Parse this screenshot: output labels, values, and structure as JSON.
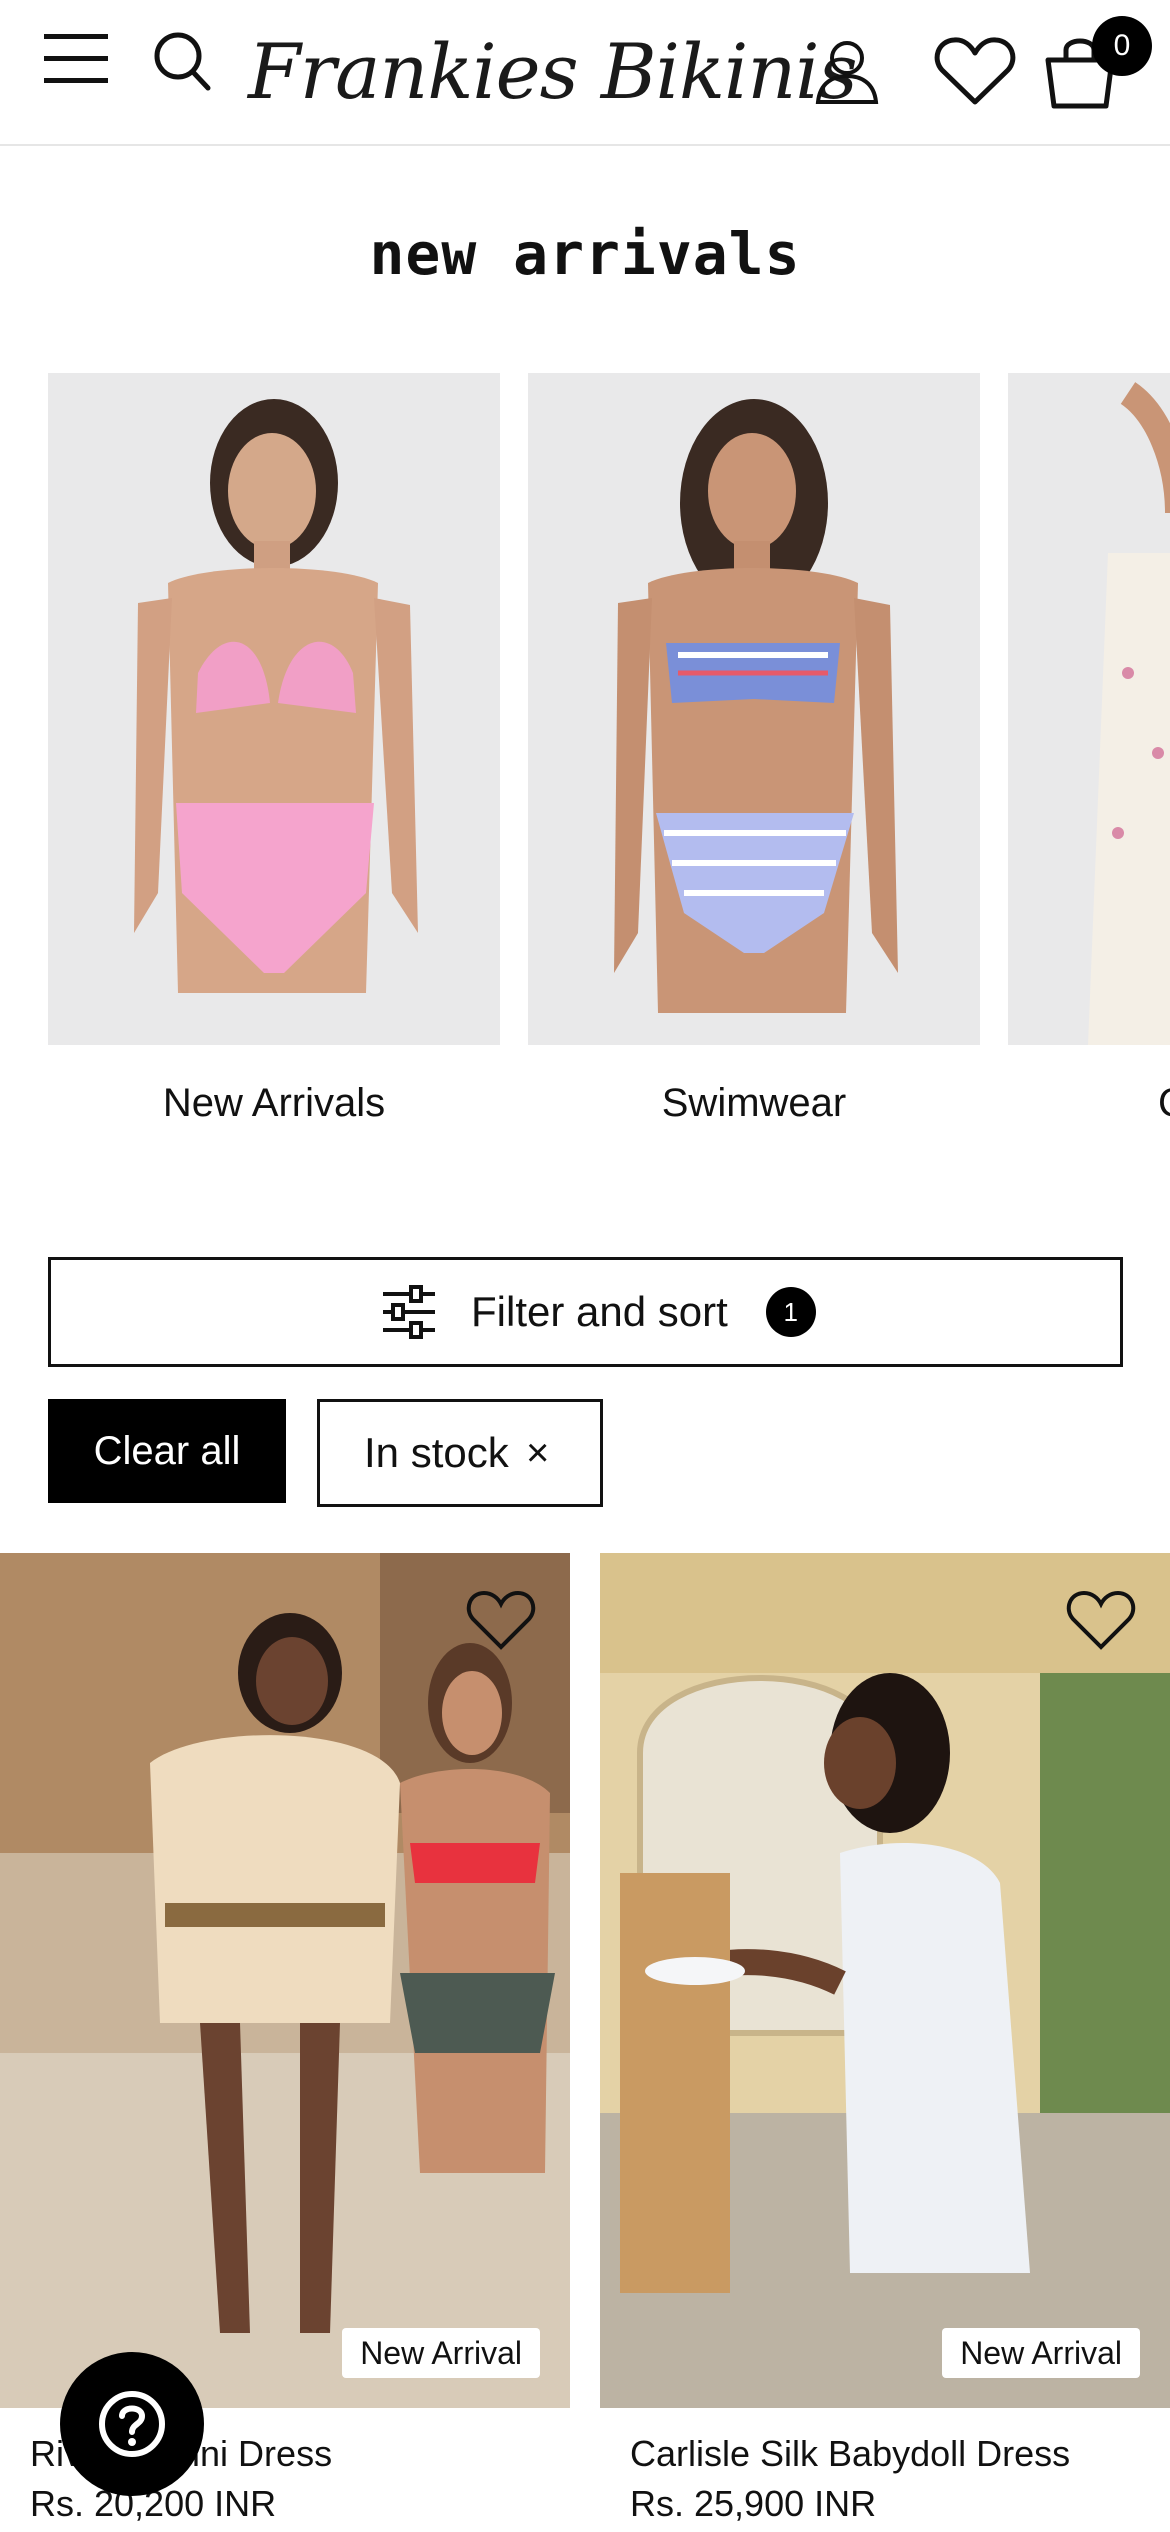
{
  "header": {
    "logo_text": "Frankies Bikinis",
    "cart_count": "0",
    "icons": [
      "menu-icon",
      "search-icon",
      "account-icon",
      "heart-icon",
      "shopping-bag-icon"
    ]
  },
  "page": {
    "title": "new arrivals"
  },
  "categories": [
    {
      "label": "New Arrivals"
    },
    {
      "label": "Swimwear"
    },
    {
      "label": "C"
    }
  ],
  "filter": {
    "label": "Filter and sort",
    "count": "1",
    "clear_label": "Clear all",
    "active_chips": [
      {
        "label": "In stock",
        "close": "×"
      }
    ]
  },
  "products": [
    {
      "name": "Riviera Cotton Mini Dress",
      "visible_name": "Riv         tton Mini Dress",
      "price": "Rs. 20,200 INR",
      "badge": "New Arrival"
    },
    {
      "name": "Carlisle Silk Babydoll Dress",
      "price": "Rs. 25,900 INR",
      "badge": "New Arrival"
    }
  ],
  "colors": {
    "text": "#111111",
    "accent": "#000000",
    "background": "#ffffff",
    "image_bg": "#e9e9ea"
  }
}
